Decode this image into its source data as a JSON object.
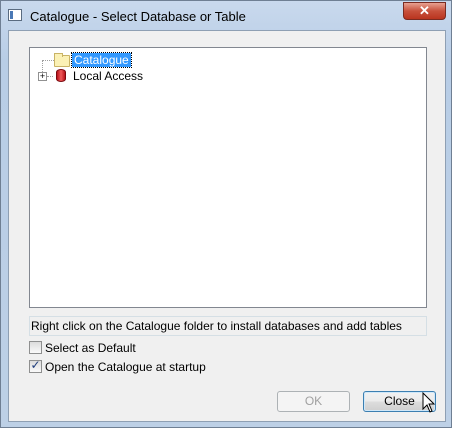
{
  "window": {
    "title": "Catalogue - Select Database or Table",
    "close_glyph": "✕"
  },
  "tree": {
    "items": [
      {
        "label": "Catalogue",
        "icon": "folder-icon",
        "selected": true
      },
      {
        "label": "Local Access",
        "icon": "database-icon",
        "expander": "+"
      }
    ]
  },
  "hint": "Right click on the Catalogue folder to install databases and add tables",
  "options": {
    "select_default": {
      "label": "Select as Default",
      "checked": false
    },
    "open_at_startup": {
      "label": "Open the Catalogue at startup",
      "checked": true,
      "mark": "✓"
    }
  },
  "buttons": {
    "ok": "OK",
    "close": "Close"
  },
  "colors": {
    "selection": "#3399ff",
    "close_button": "#c8513c"
  }
}
